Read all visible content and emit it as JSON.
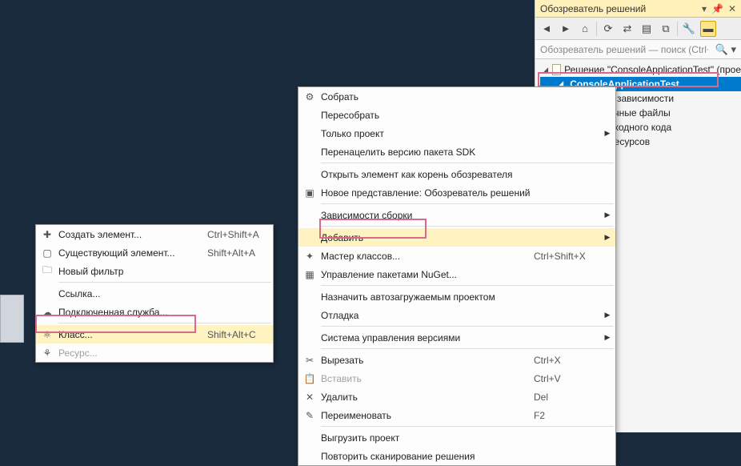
{
  "solution_explorer": {
    "title": "Обозреватель решений",
    "search_placeholder": "Обозреватель решений — поиск (Ctrl+;)",
    "solution_label": "Решение \"ConsoleApplicationTest\" (прое",
    "project_label": "ConsoleApplicationTest",
    "children": {
      "deps": "е зависимости",
      "source_files": "очные файлы",
      "source_code": "сходного кода",
      "resources": "ресурсов"
    }
  },
  "context_menu": {
    "build": "Собрать",
    "rebuild": "Пересобрать",
    "project_only": "Только проект",
    "retarget_sdk": "Перенацелить версию пакета SDK",
    "open_root": "Открыть элемент как корень обозревателя",
    "new_view": "Новое представление: Обозреватель решений",
    "build_deps": "Зависимости сборки",
    "add": "Добавить",
    "class_wizard": "Мастер классов...",
    "class_wizard_shortcut": "Ctrl+Shift+X",
    "nuget": "Управление пакетами NuGet...",
    "set_startup": "Назначить автозагружаемым проектом",
    "debug": "Отладка",
    "source_control": "Система управления версиями",
    "cut": "Вырезать",
    "cut_shortcut": "Ctrl+X",
    "paste": "Вставить",
    "paste_shortcut": "Ctrl+V",
    "delete": "Удалить",
    "delete_shortcut": "Del",
    "rename": "Переименовать",
    "rename_shortcut": "F2",
    "unload": "Выгрузить проект",
    "rescan": "Повторить сканирование решения"
  },
  "add_submenu": {
    "new_item": "Создать элемент...",
    "new_item_shortcut": "Ctrl+Shift+A",
    "existing_item": "Существующий элемент...",
    "existing_item_shortcut": "Shift+Alt+A",
    "new_filter": "Новый фильтр",
    "reference": "Ссылка...",
    "connected_service": "Подключенная служба...",
    "class": "Класс...",
    "class_shortcut": "Shift+Alt+C",
    "resource": "Ресурс..."
  }
}
